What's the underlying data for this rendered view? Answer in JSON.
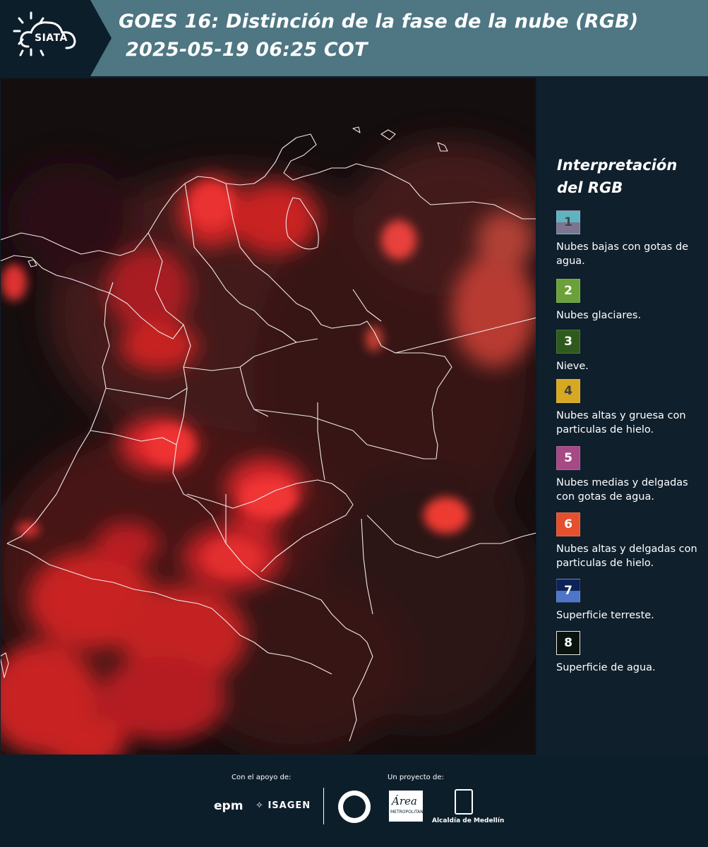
{
  "header": {
    "logo_text": "SIATA",
    "title": "GOES 16: Distinción de la fase de la nube (RGB)",
    "datetime": "2025-05-19 06:25 COT"
  },
  "legend": {
    "title": "Interpretación del RGB",
    "items": [
      {
        "number": "1",
        "label": "Nubes bajas con gotas de agua.",
        "color": "#5fb3c1 / #7b7591"
      },
      {
        "number": "2",
        "label": "Nubes glaciares.",
        "color": "#6aa239"
      },
      {
        "number": "3",
        "label": "Nieve.",
        "color": "#2f5a1e"
      },
      {
        "number": "4",
        "label": "Nubes altas y gruesa con particulas de hielo.",
        "color": "#d7a821"
      },
      {
        "number": "5",
        "label": "Nubes medias y delgadas con gotas de agua.",
        "color": "#a64985"
      },
      {
        "number": "6",
        "label": "Nubes altas y delgadas con particulas de hielo.",
        "color": "#e4502e"
      },
      {
        "number": "7",
        "label": "Superficie terreste.",
        "color": "#0d2257 / #4f75c8"
      },
      {
        "number": "8",
        "label": "Superficie de agua.",
        "color": "#09140d"
      }
    ]
  },
  "footer": {
    "support_caption": "Con el apoyo de:",
    "project_caption": "Un proyecto de:",
    "sponsors": [
      "epm",
      "ISAGEN"
    ],
    "partners": [
      "Área Metropolitana Valle de Aburrá",
      "Alcaldía de Medellín"
    ],
    "area_logo_text": "Área",
    "area_logo_sub": "METROPOLITANA",
    "medellin_label": "Alcaldía de Medellín"
  },
  "map": {
    "product": "RGB Distinción de la fase de la nube",
    "dominant_cloud_color": "#e4282a",
    "background_color": "#140d0e"
  }
}
